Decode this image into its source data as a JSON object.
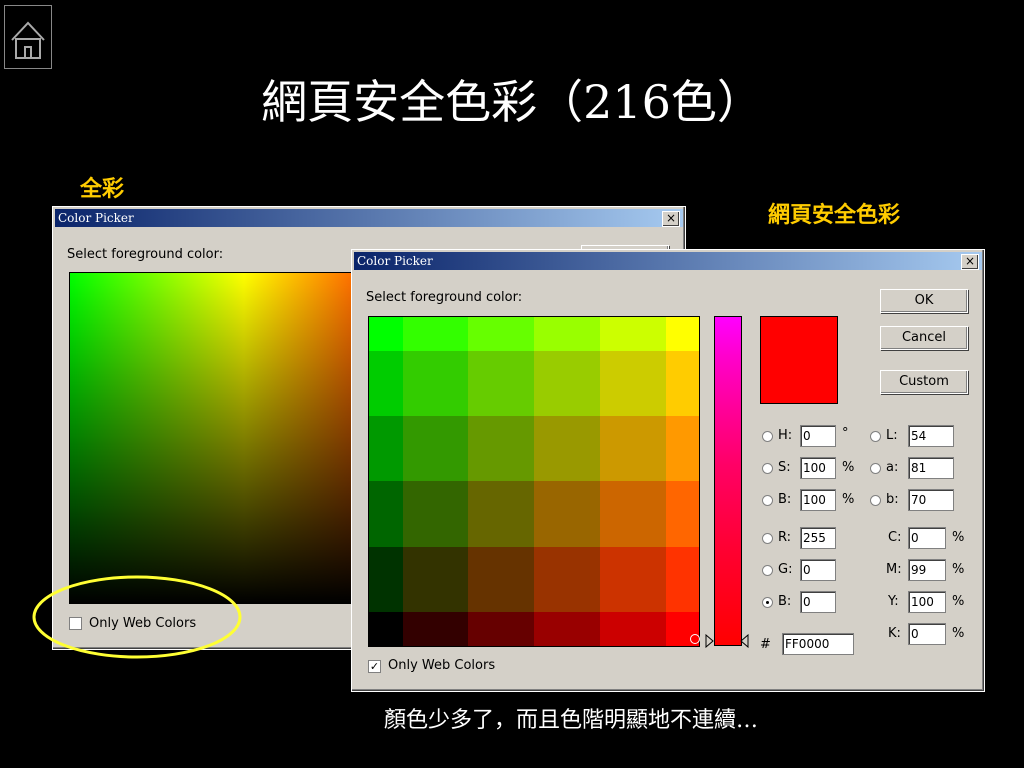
{
  "slide": {
    "title": "網頁安全色彩（216色）",
    "label_full": "全彩",
    "label_web": "網頁安全色彩",
    "caption": "顏色少多了，而且色階明顯地不連續…"
  },
  "dialog_back": {
    "title": "Color Picker",
    "close": "×",
    "prompt": "Select foreground color:",
    "only_web_label": "Only Web Colors",
    "only_web_checked": false
  },
  "dialog_front": {
    "title": "Color Picker",
    "close": "×",
    "prompt": "Select foreground color:",
    "ok": "OK",
    "cancel": "Cancel",
    "custom": "Custom",
    "fields": {
      "h": {
        "label": "H:",
        "value": "0",
        "unit": "°"
      },
      "s": {
        "label": "S:",
        "value": "100",
        "unit": "%"
      },
      "bri": {
        "label": "B:",
        "value": "100",
        "unit": "%"
      },
      "r": {
        "label": "R:",
        "value": "255"
      },
      "g": {
        "label": "G:",
        "value": "0"
      },
      "b": {
        "label": "B:",
        "value": "0"
      },
      "l": {
        "label": "L:",
        "value": "54"
      },
      "a": {
        "label": "a:",
        "value": "81"
      },
      "lab_b": {
        "label": "b:",
        "value": "70"
      },
      "c": {
        "label": "C:",
        "value": "0",
        "unit": "%"
      },
      "m": {
        "label": "M:",
        "value": "99",
        "unit": "%"
      },
      "y": {
        "label": "Y:",
        "value": "100",
        "unit": "%"
      },
      "k": {
        "label": "K:",
        "value": "0",
        "unit": "%"
      }
    },
    "hex_symbol": "#",
    "hex_value": "FF0000",
    "only_web_label": "Only Web Colors",
    "only_web_checked": true,
    "check_mark": "✓",
    "selected_radio": "b",
    "current_color": "#ff0000"
  },
  "swatches": [
    [
      "#00ff00",
      "#33ff00",
      "#66ff00",
      "#99ff00",
      "#ccff00",
      "#ffff00"
    ],
    [
      "#00cc00",
      "#33cc00",
      "#66cc00",
      "#99cc00",
      "#cccc00",
      "#ffcc00"
    ],
    [
      "#009900",
      "#339900",
      "#669900",
      "#999900",
      "#cc9900",
      "#ff9900"
    ],
    [
      "#006600",
      "#336600",
      "#666600",
      "#996600",
      "#cc6600",
      "#ff6600"
    ],
    [
      "#003300",
      "#333300",
      "#663300",
      "#993300",
      "#cc3300",
      "#ff3300"
    ],
    [
      "#000000",
      "#330000",
      "#660000",
      "#990000",
      "#cc0000",
      "#ff0000"
    ]
  ],
  "colors": {
    "accent_label": "#ffcc00",
    "highlight_ring": "#ffff33"
  }
}
